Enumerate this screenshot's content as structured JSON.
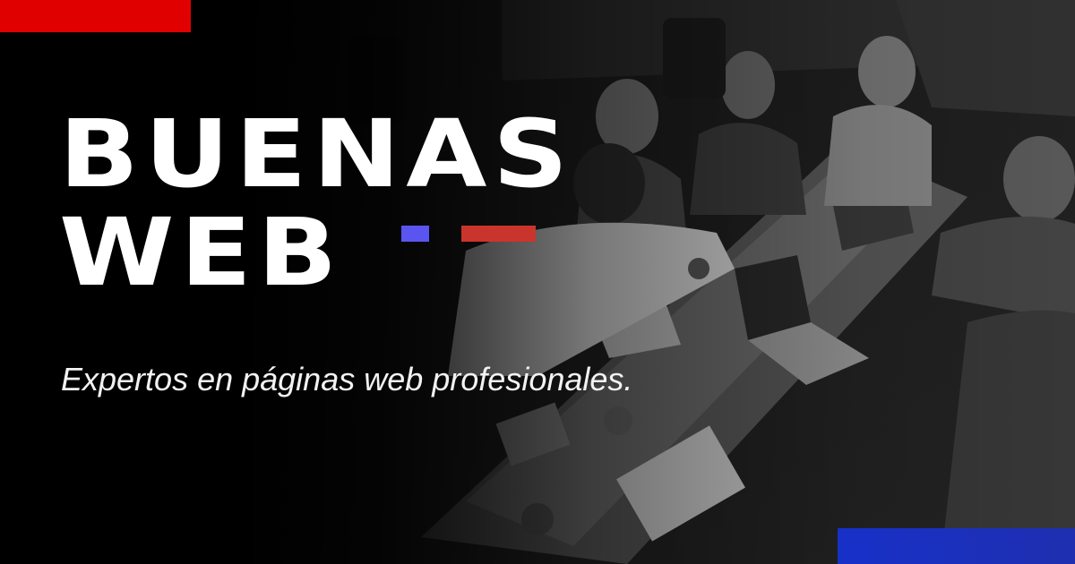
{
  "brand": {
    "line1": "BUENAS",
    "line2": "WEB"
  },
  "tagline": "Expertos en páginas web profesionales.",
  "colors": {
    "accent_red": "#e00000",
    "accent_red_dash": "#c9352c",
    "accent_blue": "#1730c8",
    "accent_blue_dash": "#5a55f0",
    "text": "#ffffff",
    "background": "#000000"
  },
  "image": {
    "background_photo": "office-team-high-five-photo"
  }
}
